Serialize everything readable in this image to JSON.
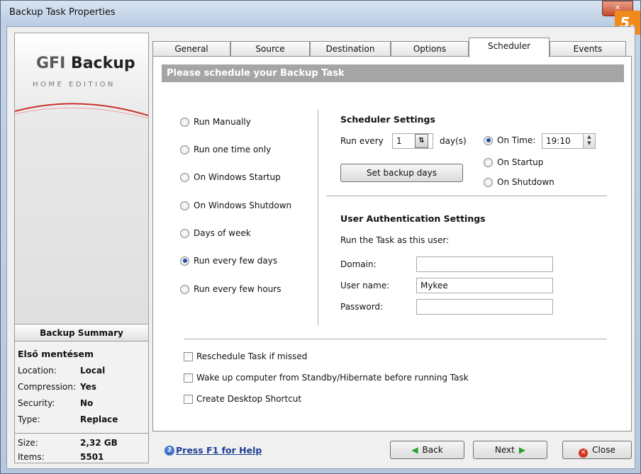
{
  "window": {
    "title": "Backup Task Properties",
    "close": "✕",
    "step_badge": "5."
  },
  "sidebar": {
    "logo_gfi": "GFI ",
    "logo_backup": "Backup",
    "logo_edition": "HOME EDITION",
    "summary_title": "Backup Summary",
    "task_name": "Első mentésem",
    "rows": [
      {
        "key": "Location:",
        "value": "Local"
      },
      {
        "key": "Compression:",
        "value": "Yes"
      },
      {
        "key": "Security:",
        "value": "No"
      },
      {
        "key": "Type:",
        "value": "Replace"
      },
      {
        "key": "Size:",
        "value": "2,32 GB"
      },
      {
        "key": "Items:",
        "value": "5501"
      }
    ]
  },
  "tabs": [
    {
      "label": "General"
    },
    {
      "label": "Source"
    },
    {
      "label": "Destination"
    },
    {
      "label": "Options"
    },
    {
      "label": "Scheduler",
      "active": true
    },
    {
      "label": "Events"
    }
  ],
  "banner": "Please schedule your Backup Task",
  "schedule_options": [
    {
      "label": "Run Manually",
      "selected": false
    },
    {
      "label": "Run one time only",
      "selected": false
    },
    {
      "label": "On Windows Startup",
      "selected": false
    },
    {
      "label": "On Windows Shutdown",
      "selected": false
    },
    {
      "label": "Days of week",
      "selected": false
    },
    {
      "label": "Run every few days",
      "selected": true
    },
    {
      "label": "Run every few hours",
      "selected": false
    }
  ],
  "scheduler_settings": {
    "title": "Scheduler Settings",
    "run_every_label": "Run every",
    "run_every_value": "1",
    "unit": "day(s)",
    "set_days_button": "Set backup days",
    "on_time_label": "On Time:",
    "on_time_value": "19:10",
    "on_startup_label": "On Startup",
    "on_shutdown_label": "On Shutdown",
    "selected_trigger": "on_time"
  },
  "auth": {
    "title": "User Authentication Settings",
    "subtitle": "Run the Task as this user:",
    "domain_label": "Domain:",
    "domain_value": "",
    "username_label": "User name:",
    "username_value": "Mykee",
    "password_label": "Password:",
    "password_value": ""
  },
  "options": [
    {
      "label": "Reschedule Task if missed",
      "checked": false
    },
    {
      "label": "Wake up computer from Standby/Hibernate before running Task",
      "checked": false
    },
    {
      "label": "Create Desktop Shortcut",
      "checked": false
    }
  ],
  "footer": {
    "help": "Press F1 for Help",
    "back": "Back",
    "next": "Next",
    "close": "Close"
  },
  "colors": {
    "banner": "#a5a5a5",
    "accent": "#1f4fa8",
    "badge": "#f08a1c"
  }
}
